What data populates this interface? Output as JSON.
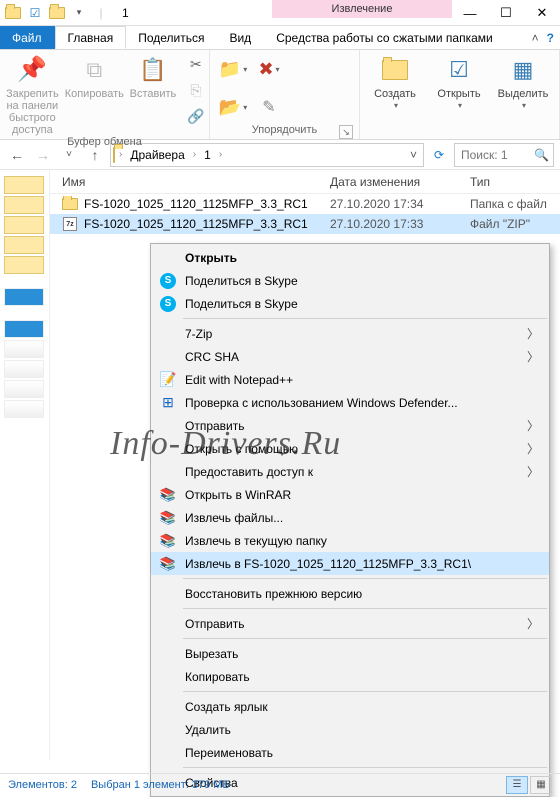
{
  "window": {
    "title": "1",
    "context_tab": "Извлечение"
  },
  "tabs": {
    "file": "Файл",
    "home": "Главная",
    "share": "Поделиться",
    "view": "Вид",
    "context": "Средства работы со сжатыми папками"
  },
  "ribbon": {
    "clipboard": {
      "pin": "Закрепить на панели\nбыстрого доступа",
      "copy": "Копировать",
      "paste": "Вставить",
      "label": "Буфер обмена"
    },
    "organize": {
      "label": "Упорядочить"
    },
    "new_group": {
      "create": "Создать",
      "open": "Открыть",
      "select": "Выделить"
    }
  },
  "breadcrumb": {
    "items": [
      "Драйвера",
      "1"
    ]
  },
  "search": {
    "placeholder": "Поиск: 1"
  },
  "columns": {
    "name": "Имя",
    "date": "Дата изменения",
    "type": "Тип"
  },
  "rows": [
    {
      "icon": "folder",
      "name": "FS-1020_1025_1120_1125MFP_3.3_RC1",
      "date": "27.10.2020 17:34",
      "type": "Папка с файл",
      "selected": false
    },
    {
      "icon": "zip",
      "name": "FS-1020_1025_1120_1125MFP_3.3_RC1",
      "date": "27.10.2020 17:33",
      "type": "Файл \"ZIP\"",
      "selected": true
    }
  ],
  "context_menu": [
    {
      "type": "item",
      "bold": true,
      "label": "Открыть"
    },
    {
      "type": "item",
      "icon": "skype",
      "label": "Поделиться в Skype"
    },
    {
      "type": "item",
      "icon": "skype",
      "label": "Поделиться в Skype"
    },
    {
      "type": "sep"
    },
    {
      "type": "item",
      "sub": true,
      "label": "7-Zip"
    },
    {
      "type": "item",
      "sub": true,
      "label": "CRC SHA"
    },
    {
      "type": "item",
      "icon": "npp",
      "label": "Edit with Notepad++"
    },
    {
      "type": "item",
      "icon": "defender",
      "label": "Проверка с использованием Windows Defender..."
    },
    {
      "type": "item",
      "sub": true,
      "label": "Отправить"
    },
    {
      "type": "item",
      "sub": true,
      "label": "Открыть с помощью"
    },
    {
      "type": "item",
      "sub": true,
      "label": "Предоставить доступ к"
    },
    {
      "type": "item",
      "icon": "rar",
      "label": "Открыть в WinRAR"
    },
    {
      "type": "item",
      "icon": "rar",
      "label": "Извлечь файлы..."
    },
    {
      "type": "item",
      "icon": "rar",
      "label": "Извлечь в текущую папку"
    },
    {
      "type": "item",
      "icon": "rar",
      "hover": true,
      "label": "Извлечь в FS-1020_1025_1120_1125MFP_3.3_RC1\\"
    },
    {
      "type": "sep"
    },
    {
      "type": "item",
      "label": "Восстановить прежнюю версию"
    },
    {
      "type": "sep"
    },
    {
      "type": "item",
      "sub": true,
      "label": "Отправить"
    },
    {
      "type": "sep"
    },
    {
      "type": "item",
      "label": "Вырезать"
    },
    {
      "type": "item",
      "label": "Копировать"
    },
    {
      "type": "sep"
    },
    {
      "type": "item",
      "label": "Создать ярлык"
    },
    {
      "type": "item",
      "label": "Удалить"
    },
    {
      "type": "item",
      "label": "Переименовать"
    },
    {
      "type": "sep"
    },
    {
      "type": "item",
      "label": "Свойства"
    }
  ],
  "status": {
    "count": "Элементов: 2",
    "selection": "Выбран 1 элемент: 379 МБ"
  },
  "watermark": "Info-Drivers.Ru"
}
